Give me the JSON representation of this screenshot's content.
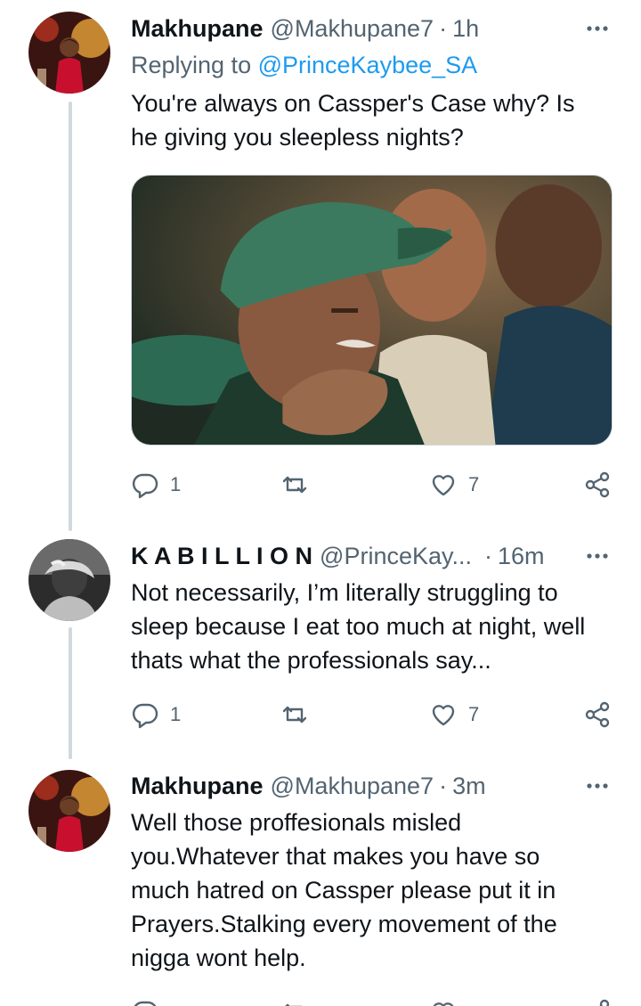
{
  "tweets": [
    {
      "display_name": "Makhupane",
      "handle": "@Makhupane7",
      "separator": "·",
      "time": "1h",
      "replying_prefix": "Replying to",
      "replying_to": "@PrinceKaybee_SA",
      "text_lines": [
        "You're always on Cassper's Case why? Is",
        "he giving you sleepless nights?"
      ],
      "has_media": true,
      "replies": "1",
      "retweets": "",
      "likes": "7",
      "avatar": "red-jersey-footballer-avatar"
    },
    {
      "display_name": "K A B I L L I O N",
      "handle": "@PrinceKay...",
      "separator": "·",
      "time": "16m",
      "text_lines": [
        "Not necessarily, I’m literally struggling to",
        "sleep because I eat too much at night, well",
        "thats what the professionals say..."
      ],
      "replies": "1",
      "retweets": "",
      "likes": "7",
      "avatar": "grayscale-portrait-avatar"
    },
    {
      "display_name": "Makhupane",
      "handle": "@Makhupane7",
      "separator": "·",
      "time": "3m",
      "text_lines": [
        "Well those proffesionals misled",
        "you.Whatever that makes you have so",
        "much hatred on Cassper please put it in",
        "Prayers.Stalking every movement of the",
        "nigga wont help."
      ],
      "avatar": "red-jersey-footballer-avatar"
    }
  ],
  "icons": {
    "more": "more-horizontal-icon",
    "reply": "reply-bubble-icon",
    "retweet": "retweet-icon",
    "like": "heart-icon",
    "share": "share-icon"
  },
  "colors": {
    "text": "#0f1419",
    "muted": "#536471",
    "link": "#1d9bf0",
    "thread_line": "#cfd9de"
  }
}
